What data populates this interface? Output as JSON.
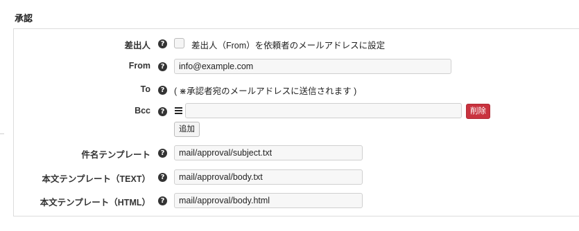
{
  "section": {
    "title": "承認"
  },
  "rows": {
    "sender": {
      "label": "差出人",
      "checkbox_label": "差出人（From）を依頼者のメールアドレスに設定",
      "checked": false
    },
    "from": {
      "label": "From",
      "value": "info@example.com"
    },
    "to": {
      "label": "To",
      "text": "( ⋇承認者宛のメールアドレスに送信されます )"
    },
    "bcc": {
      "label": "Bcc",
      "value": "",
      "delete_label": "削除",
      "add_label": "追加"
    },
    "subject_template": {
      "label": "件名テンプレート",
      "value": "mail/approval/subject.txt"
    },
    "body_text_template": {
      "label": "本文テンプレート（TEXT）",
      "value": "mail/approval/body.txt"
    },
    "body_html_template": {
      "label": "本文テンプレート（HTML）",
      "value": "mail/approval/body.html"
    }
  },
  "help_icon": "?",
  "colors": {
    "delete_button": "#c9333f",
    "help_icon": "#333333"
  }
}
